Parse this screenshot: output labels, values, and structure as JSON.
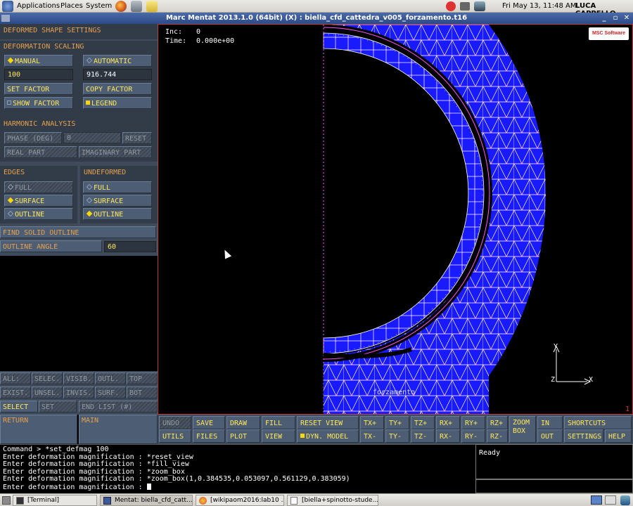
{
  "panel": {
    "applications": "Applications",
    "places": "Places",
    "system": "System",
    "clock": "Fri May 13, 11:48 AM",
    "user": "LUCA CAPPELLO"
  },
  "window": {
    "title": "Marc Mentat 2013.1.0 (64bit) (X) : biella_cfd_cattedra_v005_forzamento.t16",
    "minimize": "_",
    "maximize": "▫",
    "close": "✕"
  },
  "left": {
    "title": "DEFORMED SHAPE SETTINGS",
    "scaling_header": "DEFORMATION SCALING",
    "manual": "MANUAL",
    "automatic": "AUTOMATIC",
    "manual_value": "100",
    "automatic_value": "916.744",
    "set_factor": "SET FACTOR",
    "copy_factor": "COPY FACTOR",
    "show_factor": "SHOW FACTOR",
    "legend": "LEGEND",
    "harmonic_header": "HARMONIC ANALYSIS",
    "phase": "PHASE (DEG)",
    "phase_value": "0",
    "reset": "RESET",
    "real_part": "REAL PART",
    "imaginary_part": "IMAGINARY PART",
    "edges_header": "EDGES",
    "undeformed_header": "UNDEFORMED",
    "full": "FULL",
    "surface": "SURFACE",
    "outline": "OUTLINE",
    "find_solid_outline": "FIND SOLID OUTLINE",
    "outline_angle": "OUTLINE ANGLE",
    "outline_angle_value": "60",
    "sel": {
      "all": "ALL:",
      "selec": "SELEC.",
      "visib": "VISIB.",
      "outl": "OUTL.",
      "top": "TOP",
      "exist": "EXIST.",
      "unsel": "UNSEL.",
      "invis": "INVIS.",
      "surf": "SURF.",
      "bot": "BOT",
      "select": "SELECT",
      "set": "SET",
      "end_list": "END LIST (#)",
      "return": "RETURN",
      "main": "MAIN"
    }
  },
  "viewport": {
    "inc_label": "Inc:",
    "inc_value": "0",
    "time_label": "Time:",
    "time_value": "0.000e+00",
    "logo": "MSC Software",
    "contact_label": "forzamento",
    "axis_x": "X",
    "axis_y": "Y",
    "axis_z": "Z",
    "viewport_number": "1"
  },
  "toolbar": {
    "undo": "UNDO",
    "save": "SAVE",
    "draw": "DRAW",
    "fill": "FILL",
    "reset_view": "RESET VIEW",
    "txp": "TX+",
    "typ": "TY+",
    "tzp": "TZ+",
    "rxp": "RX+",
    "ryp": "RY+",
    "rzp": "RZ+",
    "zoom": "ZOOM",
    "box": "BOX",
    "in": "IN",
    "shortcuts": "SHORTCUTS",
    "utils": "UTILS",
    "files": "FILES",
    "plot": "PLOT",
    "view": "VIEW",
    "dyn_model": "DYN. MODEL",
    "txm": "TX-",
    "tym": "TY-",
    "tzm": "TZ-",
    "rxm": "RX-",
    "rym": "RY-",
    "rzm": "RZ-",
    "out": "OUT",
    "settings": "SETTINGS",
    "help": "HELP"
  },
  "console": {
    "lines": [
      "Command > *set_defmag 100",
      "Enter deformation magnification : *reset_view",
      "Enter deformation magnification : *fill_view",
      "Enter deformation magnification : *zoom_box",
      "Enter deformation magnification : *zoom_box(1,0.384535,0.053097,0.561129,0.383059)",
      "Enter deformation magnification :"
    ],
    "status": "Ready"
  },
  "taskbar": {
    "items": [
      "[Terminal]",
      "Mentat: biella_cfd_catt...",
      "[wikipaom2016:lab10 ...",
      "[biella+spinotto-stude..."
    ]
  },
  "colors": {
    "mesh_fill": "#1a1aff",
    "mesh_lines": "#ffffff",
    "node_marks": "#ff55ff",
    "viewport_border": "#c23b3b",
    "label_yellow": "#ffe75a",
    "header_orange": "#e6a04c"
  }
}
